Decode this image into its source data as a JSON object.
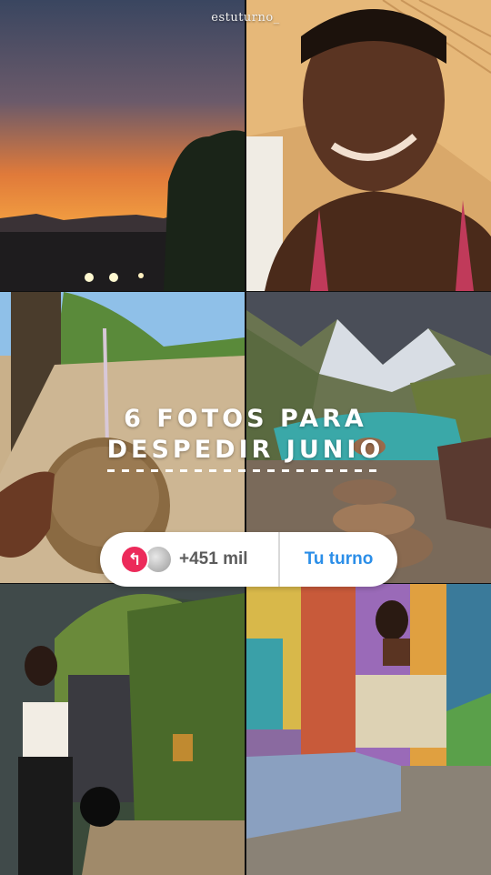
{
  "watermark": "estuturno_",
  "title": {
    "line1": "6 fotos para",
    "line2": "despedir junio"
  },
  "prompt_pill": {
    "reply_icon": "reply-arrow-icon",
    "count": "+451 mil",
    "cta_label": "Tu turno"
  },
  "colors": {
    "reply_badge": "#ec2a5a",
    "cta": "#2b8ee8"
  }
}
